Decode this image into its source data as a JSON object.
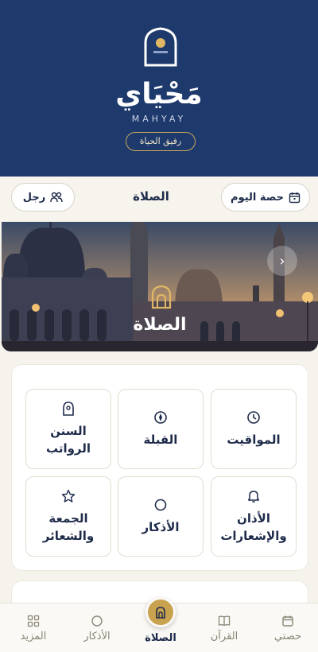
{
  "header": {
    "brand_ar": "مَحْيَاي",
    "brand_en": "MAHYAY",
    "tagline": "رفيق الحياة"
  },
  "topbar": {
    "left_label": "رجل",
    "title": "الصلاة",
    "right_label": "حصة اليوم"
  },
  "hero": {
    "title": "الصلاة",
    "next_icon": "chevron-right"
  },
  "tiles": [
    {
      "label": "المواقيت",
      "icon": "clock-icon"
    },
    {
      "label": "القبلة",
      "icon": "compass-icon"
    },
    {
      "label": "السنن الرواتب",
      "icon": "mihrab-icon"
    },
    {
      "label": "الأذان والإشعارات",
      "icon": "bell-icon"
    },
    {
      "label": "الأذكار",
      "icon": "circle-icon"
    },
    {
      "label": "الجمعة والشعائر",
      "icon": "star-icon"
    }
  ],
  "peek": {
    "text": ""
  },
  "nav": {
    "hisati": "حصتي",
    "quran": "القرآن",
    "salah": "الصلاة",
    "adhkar": "الأذكار",
    "more": "المزيد"
  },
  "colors": {
    "header_bg": "#1e3a6d",
    "accent_gold": "#c9a24f",
    "text_dark": "#1e2b4a"
  }
}
